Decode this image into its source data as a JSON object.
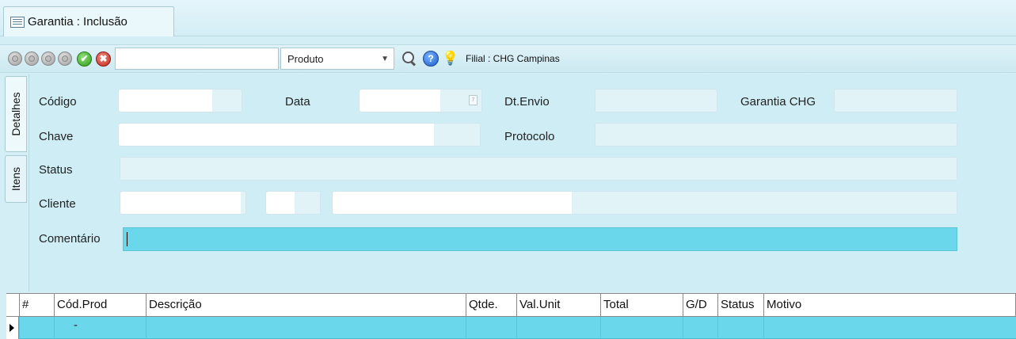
{
  "window": {
    "tab_title": "Garantia : Inclusão"
  },
  "toolbar": {
    "filter_value": "",
    "search_type": "Produto",
    "filial_label": "Filial : CHG Campinas",
    "icons": [
      "first-icon",
      "prev-icon",
      "next-icon",
      "last-icon",
      "confirm-icon",
      "cancel-icon",
      "search-icon",
      "help-icon",
      "lightbulb-icon"
    ]
  },
  "side_tabs": [
    "Detalhes",
    "Itens"
  ],
  "form": {
    "codigo": {
      "label": "Código",
      "value": ""
    },
    "data": {
      "label": "Data",
      "value": ""
    },
    "dt_envio": {
      "label": "Dt.Envio",
      "value": ""
    },
    "garantia_chg": {
      "label": "Garantia CHG",
      "value": ""
    },
    "chave": {
      "label": "Chave",
      "value": ""
    },
    "protocolo": {
      "label": "Protocolo",
      "value": ""
    },
    "status": {
      "label": "Status",
      "value": ""
    },
    "cliente": {
      "label": "Cliente",
      "value": ""
    },
    "comentario": {
      "label": "Comentário",
      "value": ""
    }
  },
  "grid": {
    "columns": [
      "#",
      "Cód.Prod",
      "Descrição",
      "Qtde.",
      "Val.Unit",
      "Total",
      "G/D",
      "Status",
      "Motivo"
    ],
    "rows": [
      {
        "num": "",
        "cod_prod": "-",
        "descricao": "",
        "qtde": "",
        "val_unit": "",
        "total": "",
        "gd": "",
        "status": "",
        "motivo": ""
      }
    ]
  }
}
